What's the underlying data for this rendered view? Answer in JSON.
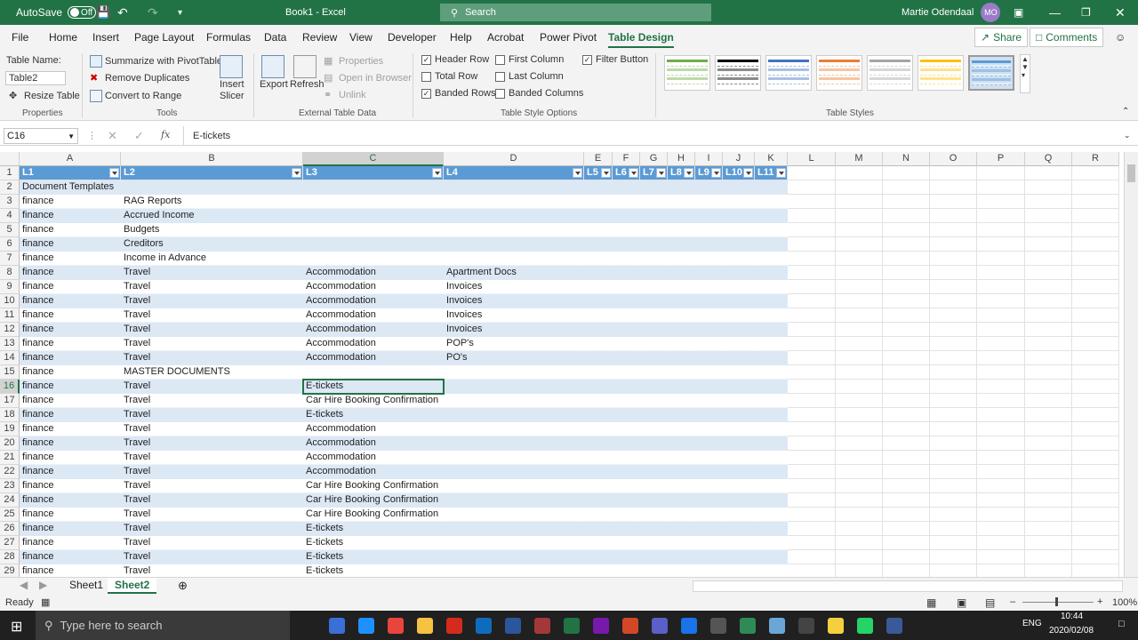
{
  "titlebar": {
    "autosave_label": "AutoSave",
    "autosave_state": "Off",
    "doc_title": "Book1  -  Excel",
    "search_placeholder": "Search",
    "user_name": "Martie Odendaal",
    "user_initials": "MO"
  },
  "tabs": [
    "File",
    "Home",
    "Insert",
    "Page Layout",
    "Formulas",
    "Data",
    "Review",
    "View",
    "Developer",
    "Help",
    "Acrobat",
    "Power Pivot",
    "Table Design"
  ],
  "active_tab": "Table Design",
  "share_label": "Share",
  "comments_label": "Comments",
  "ribbon": {
    "properties": {
      "table_name_label": "Table Name:",
      "table_name_value": "Table2",
      "resize_label": "Resize Table",
      "group": "Properties"
    },
    "tools": {
      "summarize": "Summarize with PivotTable",
      "remove_dup": "Remove Duplicates",
      "convert": "Convert to Range",
      "insert_slicer_1": "Insert",
      "insert_slicer_2": "Slicer",
      "group": "Tools"
    },
    "external": {
      "export": "Export",
      "refresh": "Refresh",
      "properties": "Properties",
      "open_browser": "Open in Browser",
      "unlink": "Unlink",
      "group": "External Table Data"
    },
    "style_options": {
      "header_row": "Header Row",
      "total_row": "Total Row",
      "banded_rows": "Banded Rows",
      "first_column": "First Column",
      "last_column": "Last Column",
      "banded_columns": "Banded Columns",
      "filter_button": "Filter Button",
      "group": "Table Style Options",
      "checked": {
        "header_row": true,
        "total_row": false,
        "banded_rows": true,
        "first_column": false,
        "last_column": false,
        "banded_columns": false,
        "filter_button": true
      }
    },
    "styles": {
      "group": "Table Styles",
      "colors": [
        "#70ad47",
        "#000000",
        "#4472c4",
        "#ed7d31",
        "#a5a5a5",
        "#ffc000",
        "#5b9bd5"
      ]
    }
  },
  "formula_bar": {
    "name_box": "C16",
    "fx": "fx",
    "formula": "E-tickets"
  },
  "columns": [
    "A",
    "B",
    "C",
    "D",
    "E",
    "F",
    "G",
    "H",
    "I",
    "J",
    "K",
    "L",
    "M",
    "N",
    "O",
    "P",
    "Q",
    "R"
  ],
  "selected_column": "C",
  "headers": [
    "L1",
    "L2",
    "L3",
    "L4",
    "L5",
    "L6",
    "L7",
    "L8",
    "L9",
    "L10",
    "L11"
  ],
  "rows": [
    {
      "n": "2",
      "A": "Document Templates",
      "B": "",
      "C": "",
      "D": ""
    },
    {
      "n": "3",
      "A": "finance",
      "B": "RAG Reports",
      "C": "",
      "D": ""
    },
    {
      "n": "4",
      "A": "finance",
      "B": "Accrued Income",
      "C": "",
      "D": ""
    },
    {
      "n": "5",
      "A": "finance",
      "B": "Budgets",
      "C": "",
      "D": ""
    },
    {
      "n": "6",
      "A": "finance",
      "B": "Creditors",
      "C": "",
      "D": ""
    },
    {
      "n": "7",
      "A": "finance",
      "B": "Income in Advance",
      "C": "",
      "D": ""
    },
    {
      "n": "8",
      "A": "finance",
      "B": "Travel",
      "C": "Accommodation",
      "D": "Apartment Docs"
    },
    {
      "n": "9",
      "A": "finance",
      "B": "Travel",
      "C": "Accommodation",
      "D": "Invoices"
    },
    {
      "n": "10",
      "A": "finance",
      "B": "Travel",
      "C": "Accommodation",
      "D": "Invoices"
    },
    {
      "n": "11",
      "A": "finance",
      "B": "Travel",
      "C": "Accommodation",
      "D": "Invoices"
    },
    {
      "n": "12",
      "A": "finance",
      "B": "Travel",
      "C": "Accommodation",
      "D": "Invoices"
    },
    {
      "n": "13",
      "A": "finance",
      "B": "Travel",
      "C": "Accommodation",
      "D": "POP's"
    },
    {
      "n": "14",
      "A": "finance",
      "B": "Travel",
      "C": "Accommodation",
      "D": "PO's"
    },
    {
      "n": "15",
      "A": "finance",
      "B": "MASTER DOCUMENTS",
      "C": "",
      "D": ""
    },
    {
      "n": "16",
      "A": "finance",
      "B": "Travel",
      "C": "E-tickets",
      "D": ""
    },
    {
      "n": "17",
      "A": "finance",
      "B": "Travel",
      "C": "Car Hire Booking Confirmation",
      "D": ""
    },
    {
      "n": "18",
      "A": "finance",
      "B": "Travel",
      "C": "E-tickets",
      "D": ""
    },
    {
      "n": "19",
      "A": "finance",
      "B": "Travel",
      "C": "Accommodation",
      "D": ""
    },
    {
      "n": "20",
      "A": "finance",
      "B": "Travel",
      "C": "Accommodation",
      "D": ""
    },
    {
      "n": "21",
      "A": "finance",
      "B": "Travel",
      "C": "Accommodation",
      "D": ""
    },
    {
      "n": "22",
      "A": "finance",
      "B": "Travel",
      "C": "Accommodation",
      "D": ""
    },
    {
      "n": "23",
      "A": "finance",
      "B": "Travel",
      "C": "Car Hire Booking Confirmation",
      "D": ""
    },
    {
      "n": "24",
      "A": "finance",
      "B": "Travel",
      "C": "Car Hire Booking Confirmation",
      "D": ""
    },
    {
      "n": "25",
      "A": "finance",
      "B": "Travel",
      "C": "Car Hire Booking Confirmation",
      "D": ""
    },
    {
      "n": "26",
      "A": "finance",
      "B": "Travel",
      "C": "E-tickets",
      "D": ""
    },
    {
      "n": "27",
      "A": "finance",
      "B": "Travel",
      "C": "E-tickets",
      "D": ""
    },
    {
      "n": "28",
      "A": "finance",
      "B": "Travel",
      "C": "E-tickets",
      "D": ""
    },
    {
      "n": "29",
      "A": "finance",
      "B": "Travel",
      "C": "E-tickets",
      "D": ""
    }
  ],
  "active_row": "16",
  "sheets": [
    "Sheet1",
    "Sheet2"
  ],
  "active_sheet": "Sheet2",
  "status": {
    "ready": "Ready",
    "zoom": "100%"
  },
  "taskbar": {
    "search_placeholder": "Type here to search",
    "lang": "ENG",
    "time": "10:44",
    "date": "2020/02/08"
  }
}
